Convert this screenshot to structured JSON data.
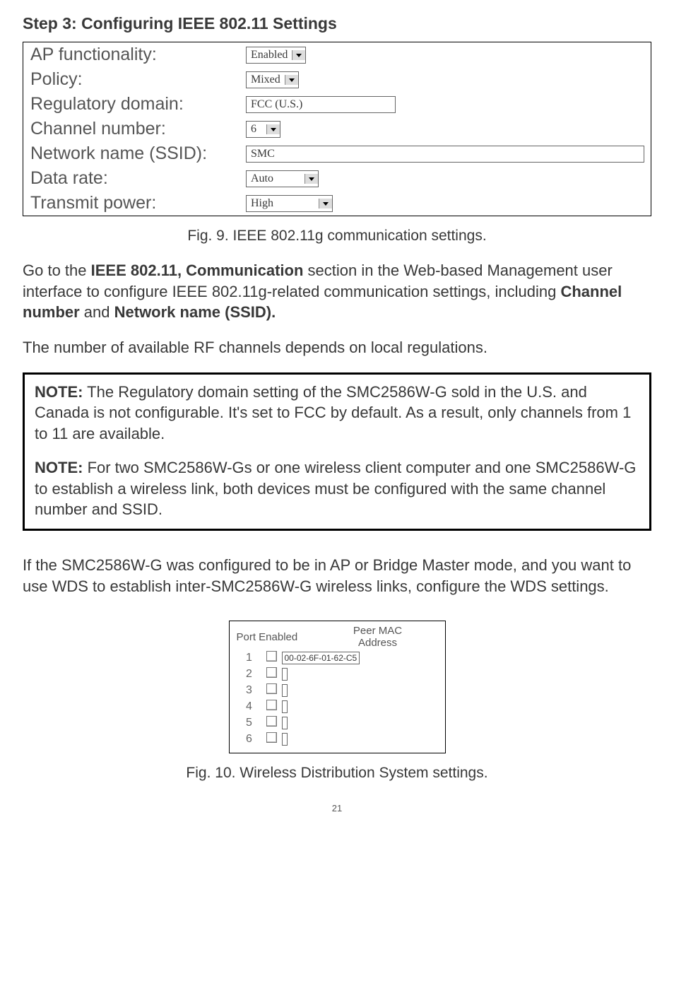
{
  "step_heading": "Step 3: Configuring IEEE 802.11 Settings",
  "settings": {
    "ap_functionality": {
      "label": "AP functionality:",
      "value": "Enabled"
    },
    "policy": {
      "label": "Policy:",
      "value": "Mixed"
    },
    "regulatory_domain": {
      "label": "Regulatory domain:",
      "value": "FCC (U.S.)"
    },
    "channel_number": {
      "label": "Channel number:",
      "value": "6"
    },
    "ssid": {
      "label": "Network name (SSID):",
      "value": "SMC"
    },
    "data_rate": {
      "label": "Data rate:",
      "value": "Auto"
    },
    "transmit_power": {
      "label": "Transmit power:",
      "value": "High"
    }
  },
  "fig9_caption": "Fig. 9. IEEE 802.11g communication settings.",
  "para1_pre": "Go to the ",
  "para1_b1": "IEEE 802.11, Communication",
  "para1_mid": " section in the Web-based Management user interface to configure IEEE 802.11g-related communication settings, including ",
  "para1_b2": "Channel number",
  "para1_and": " and ",
  "para1_b3": "Network name (SSID).",
  "para2": "The number of available RF channels depends on local regulations.",
  "note1_label": "NOTE:",
  "note1_text": " The Regulatory domain setting of the SMC2586W-G sold in the U.S. and Canada is not configurable. It's set to FCC by default. As a result, only channels from 1 to 11 are available.",
  "note2_label": "NOTE:",
  "note2_text": " For two SMC2586W-Gs or one wireless client computer and one SMC2586W-G to establish a wireless link, both devices must be configured with the same channel number and SSID.",
  "para3": "If the SMC2586W-G was configured to be in AP or Bridge Master mode, and you want to use WDS to establish inter-SMC2586W-G wireless links, configure the WDS settings.",
  "wds": {
    "head_port_enabled": "Port Enabled",
    "head_peer_mac_l1": "Peer MAC",
    "head_peer_mac_l2": "Address",
    "rows": [
      {
        "port": "1",
        "mac": "00-02-6F-01-62-C5"
      },
      {
        "port": "2",
        "mac": ""
      },
      {
        "port": "3",
        "mac": ""
      },
      {
        "port": "4",
        "mac": ""
      },
      {
        "port": "5",
        "mac": ""
      },
      {
        "port": "6",
        "mac": ""
      }
    ]
  },
  "fig10_caption": "Fig. 10. Wireless Distribution System settings.",
  "page_number": "21"
}
